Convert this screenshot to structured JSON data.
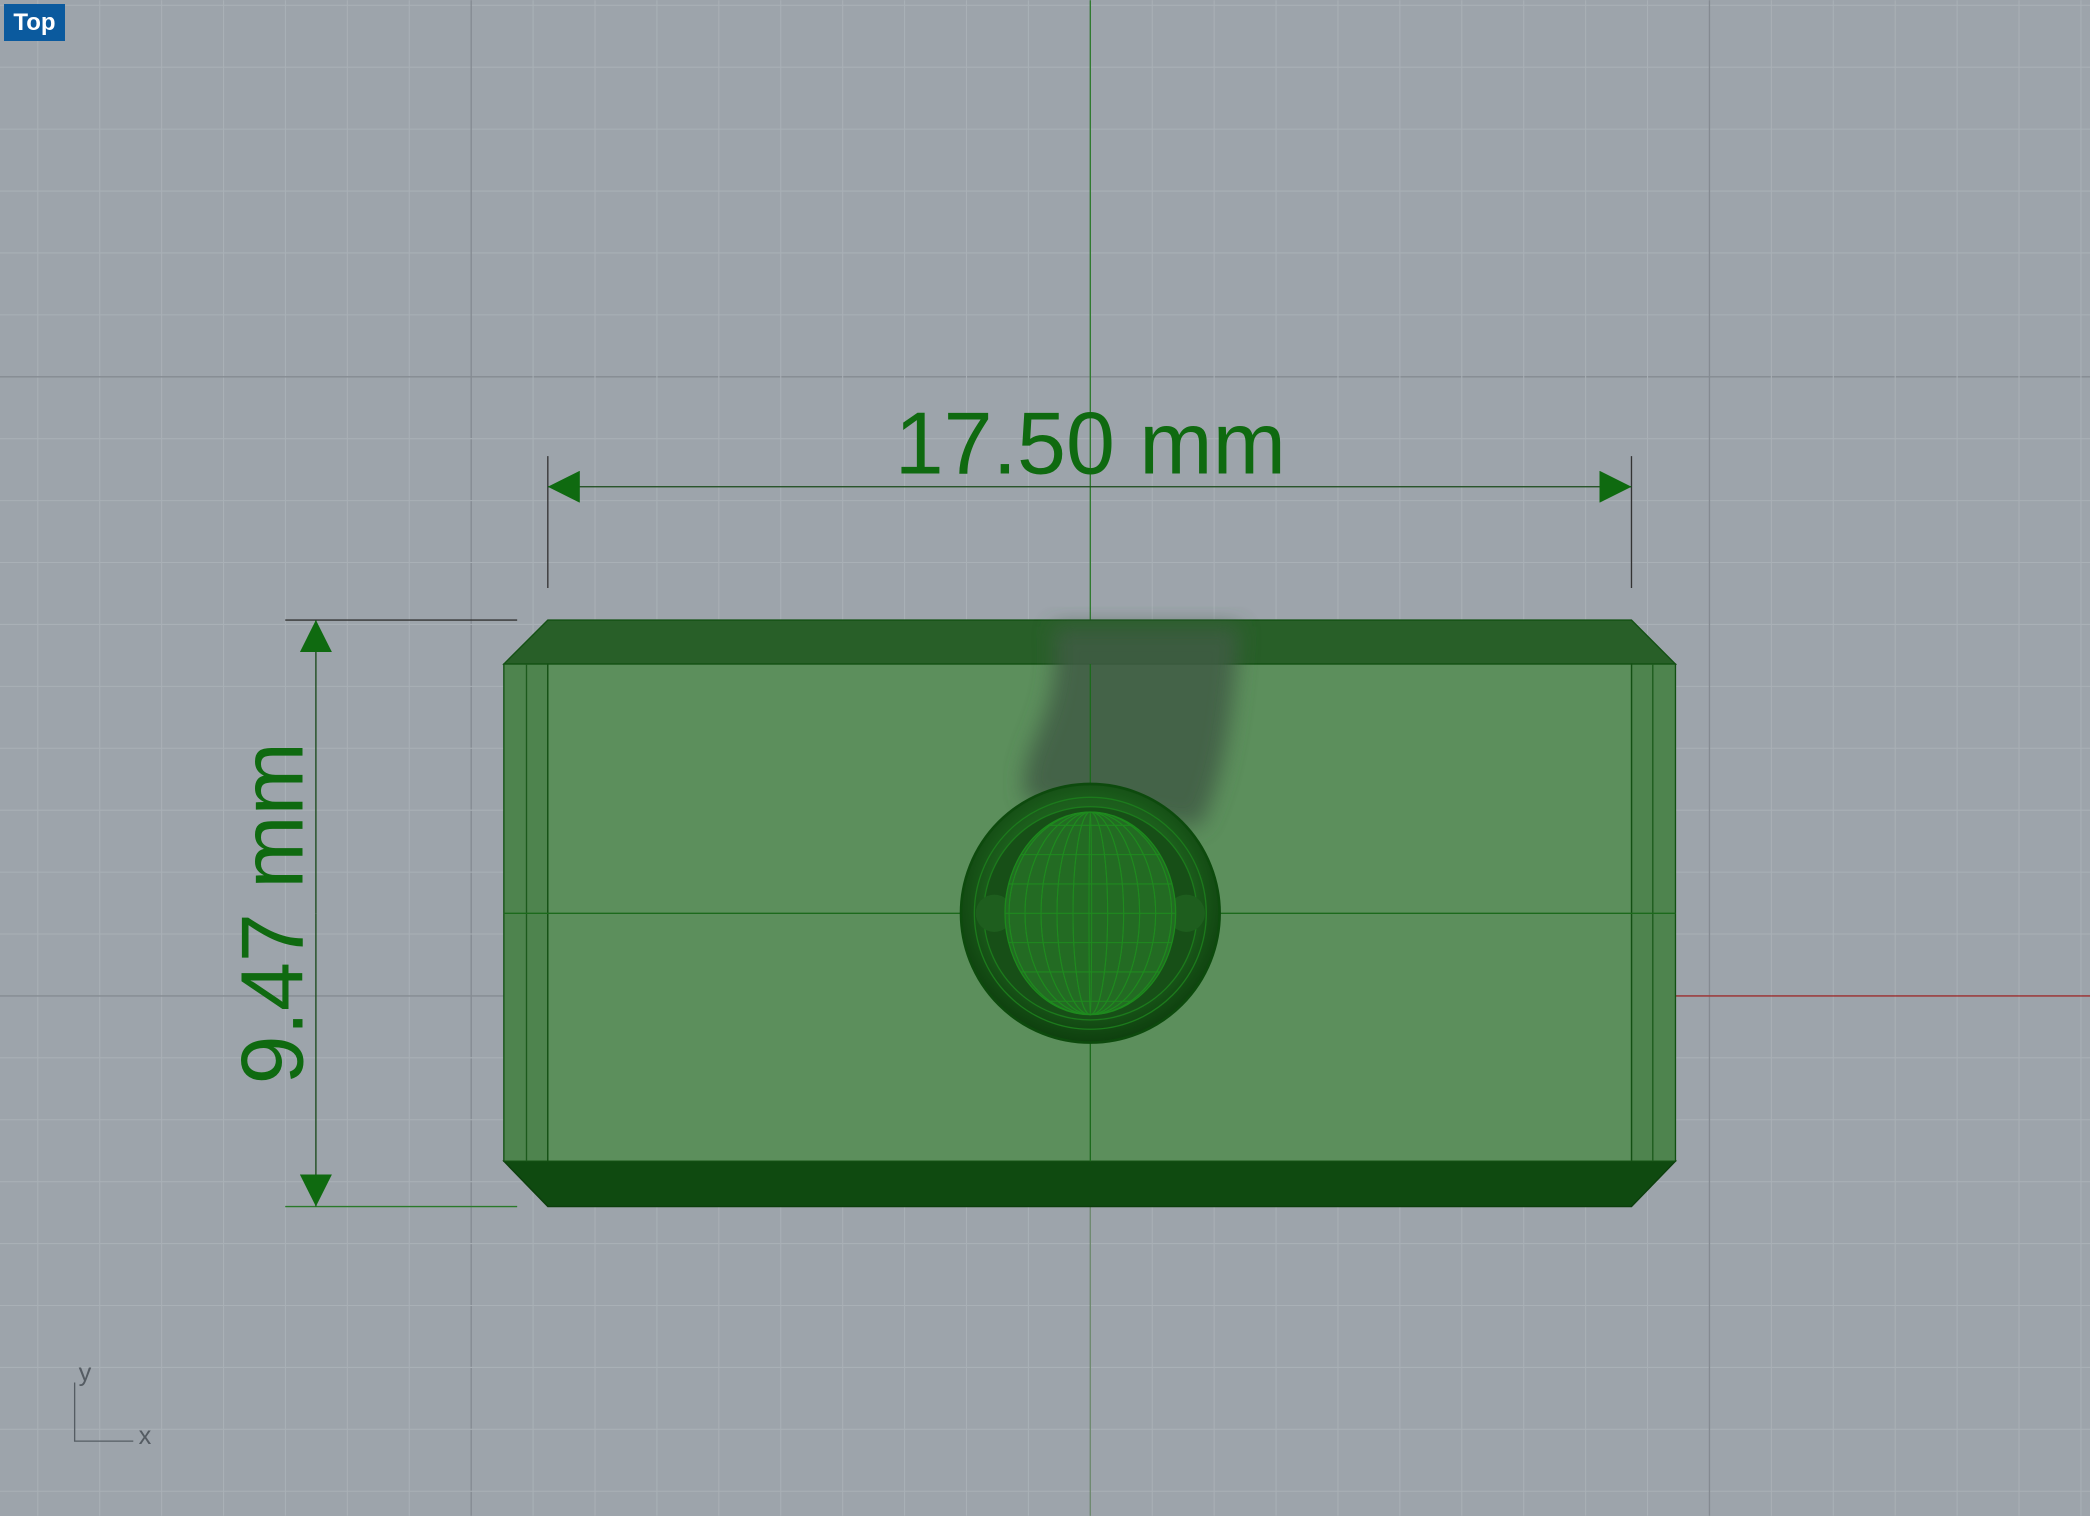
{
  "viewport": {
    "name": "Top"
  },
  "dimensions": {
    "horizontal": "17.50 mm",
    "vertical": "9.47 mm"
  },
  "axis_icon": {
    "x_label": "x",
    "y_label": "y"
  },
  "colors": {
    "grid_bg": "#9da4ab",
    "object": "#5c8f5c",
    "dimension": "#0f6a10",
    "badge": "#0b5a9e",
    "x_axis": "#a03030",
    "y_axis": "#2f7a2f"
  }
}
